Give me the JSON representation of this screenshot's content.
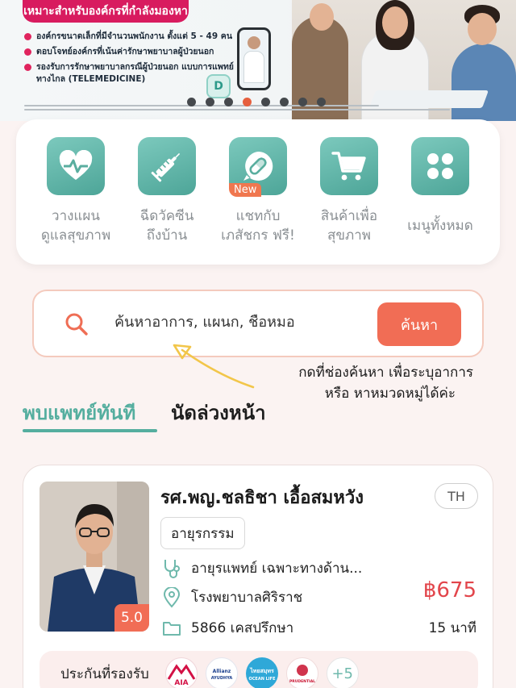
{
  "banner": {
    "ribbon": "เหมาะสำหรับองค์กรที่กำลังมองหา",
    "bullets": [
      "องค์กรขนาดเล็กที่มีจำนวนพนักงาน ตั้งแต่ 5 - 49 คน",
      "ตอบโจทย์องค์กรที่เน้นค่ารักษาพยาบาลผู้ป่วยนอก",
      "รองรับการรักษาพยาบาลกรณีผู้ป่วยนอก แบบการแพทย์ทางไกล (TELEMEDICINE)"
    ],
    "app_badge": "D",
    "carousel": {
      "count": 8,
      "active_index": 3,
      "active_color": "#e6603f"
    }
  },
  "menu": [
    {
      "line1": "วางแผน",
      "line2": "ดูแลสุขภาพ",
      "icon": "heart-pulse-icon"
    },
    {
      "line1": "ฉีดวัคซีน",
      "line2": "ถึงบ้าน",
      "icon": "syringe-icon"
    },
    {
      "line1": "แชทกับ",
      "line2": "เภสัชกร ฟรี!",
      "icon": "pill-chat-icon",
      "badge": "New"
    },
    {
      "line1": "สินค้าเพื่อ",
      "line2": "สุขภาพ",
      "icon": "cart-icon"
    },
    {
      "line1": "เมนูทั้งหมด",
      "line2": "",
      "icon": "grid-icon"
    }
  ],
  "search": {
    "placeholder": "ค้นหาอาการ, แผนก, ชื่อหมอ",
    "button": "ค้นหา"
  },
  "hint": {
    "line1": "กดที่ช่องค้นหา เพื่อระบุอาการ",
    "line2": "หรือ หาหมวดหมู่ได้ค่ะ"
  },
  "tabs": {
    "active": "พบแพทย์ทันที",
    "inactive": "นัดล่วงหน้า"
  },
  "doctor": {
    "name": "รศ.พญ.ชลธิชา เอื้อสมหวัง",
    "language": "TH",
    "specialty": "อายุรกรรม",
    "description": "อายุรแพทย์ เฉพาะทางด้าน...",
    "hospital": "โรงพยาบาลศิริราช",
    "cases": "5866 เคสปรึกษา",
    "rating": "5.0",
    "price": "฿675",
    "duration": "15 นาที",
    "insurance_label": "ประกันที่รองรับ",
    "insurance_logos": [
      {
        "name": "AIA",
        "color": "#d31145"
      },
      {
        "name": "Allianz AYUDHYA",
        "color": "#1a3e8c"
      },
      {
        "name": "ไทยสมุทร OCEAN LIFE",
        "color": "#2fa8d8"
      },
      {
        "name": "PRUDENTIAL",
        "color": "#c8102e"
      }
    ],
    "more_insurance": "+5"
  },
  "colors": {
    "accent": "#55ae9f",
    "cta": "#f16d55",
    "price": "#e2454b"
  }
}
